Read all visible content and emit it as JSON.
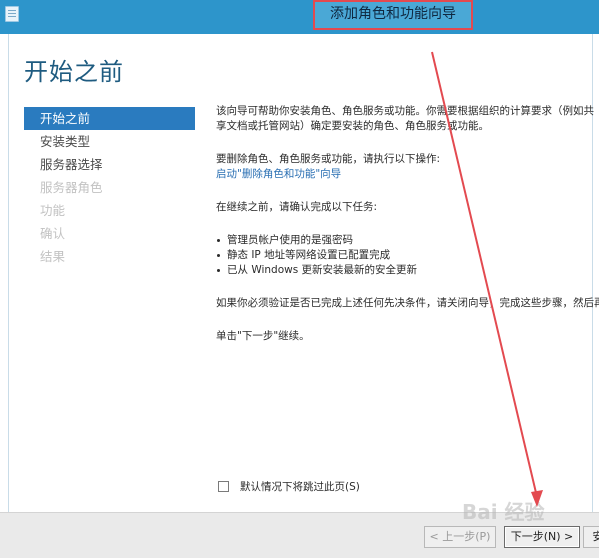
{
  "window": {
    "title": "添加角色和功能向导"
  },
  "page": {
    "title": "开始之前"
  },
  "nav": {
    "items": [
      {
        "label": "开始之前"
      },
      {
        "label": "安装类型"
      },
      {
        "label": "服务器选择"
      },
      {
        "label": "服务器角色"
      },
      {
        "label": "功能"
      },
      {
        "label": "确认"
      },
      {
        "label": "结果"
      }
    ]
  },
  "content": {
    "intro": "该向导可帮助你安装角色、角色服务或功能。你需要根据组织的计算要求（例如共享文档或托管网站）确定要安装的角色、角色服务或功能。",
    "remove_text": "要删除角色、角色服务或功能，请执行以下操作:",
    "remove_link": "启动\"删除角色和功能\"向导",
    "before_text": "在继续之前，请确认完成以下任务:",
    "tasks": [
      "管理员帐户使用的是强密码",
      "静态 IP 地址等网络设置已配置完成",
      "已从 Windows 更新安装最新的安全更新"
    ],
    "verify_text": "如果你必须验证是否已完成上述任何先决条件，请关闭向导，完成这些步骤，然后再次运行向导。",
    "next_hint": "单击\"下一步\"继续。",
    "skip_label": "默认情况下将跳过此页(S)"
  },
  "footer": {
    "prev_label": "< 上一步(P)",
    "next_label": "下一步(N) >",
    "install_label": "安"
  },
  "watermark": {
    "text": "Bai 经验"
  },
  "colors": {
    "titlebar": "#2d95cb",
    "annotation": "#e34a50",
    "nav_active": "#2a7bbf"
  }
}
